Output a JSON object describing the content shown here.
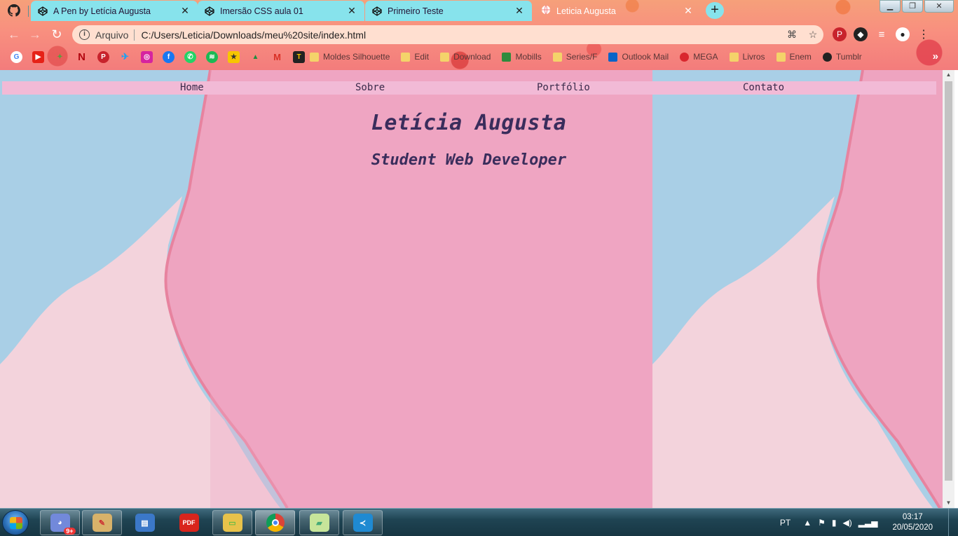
{
  "browser": {
    "tabs": [
      {
        "title": "A Pen by Letícia Augusta",
        "icon": "codepen-icon",
        "active": false
      },
      {
        "title": "Imersão CSS aula 01",
        "icon": "codepen-icon",
        "active": false
      },
      {
        "title": "Primeiro Teste",
        "icon": "codepen-icon",
        "active": false
      },
      {
        "title": "Leticia Augusta",
        "icon": "globe-icon",
        "active": true
      }
    ],
    "close_glyph": "✕",
    "new_tab_glyph": "+",
    "address": {
      "scheme_label": "Arquivo",
      "url": "C:/Users/Leticia/Downloads/meu%20site/index.html"
    },
    "bookmarks": [
      {
        "label": "Moldes Silhouette",
        "type": "folder"
      },
      {
        "label": "Edit",
        "type": "folder"
      },
      {
        "label": "Download",
        "type": "folder"
      },
      {
        "label": "Mobills",
        "type": "site"
      },
      {
        "label": "Series/F",
        "type": "folder"
      },
      {
        "label": "Outlook Mail",
        "type": "site"
      },
      {
        "label": "MEGA",
        "type": "site"
      },
      {
        "label": "Livros",
        "type": "folder"
      },
      {
        "label": "Enem",
        "type": "folder"
      },
      {
        "label": "Tumblr",
        "type": "site"
      }
    ],
    "bookmarks_more": "»"
  },
  "site": {
    "nav": [
      "Home",
      "Sobre",
      "Portfólio",
      "Contato"
    ],
    "title": "Letícia Augusta",
    "subtitle": "Student Web Developer"
  },
  "taskbar": {
    "discord_badge": "9+",
    "pdf_label": "PDF",
    "language": "PT",
    "time": "03:17",
    "date": "20/05/2020"
  },
  "colors": {
    "tab_bg": "#87e3ec",
    "nav_bar": "#f2bad6",
    "heading_text": "#3a2d5c",
    "bg_pink": "#eea4c0",
    "bg_blue": "#a9cfe6",
    "bg_light_pink": "#f3d3dc"
  }
}
